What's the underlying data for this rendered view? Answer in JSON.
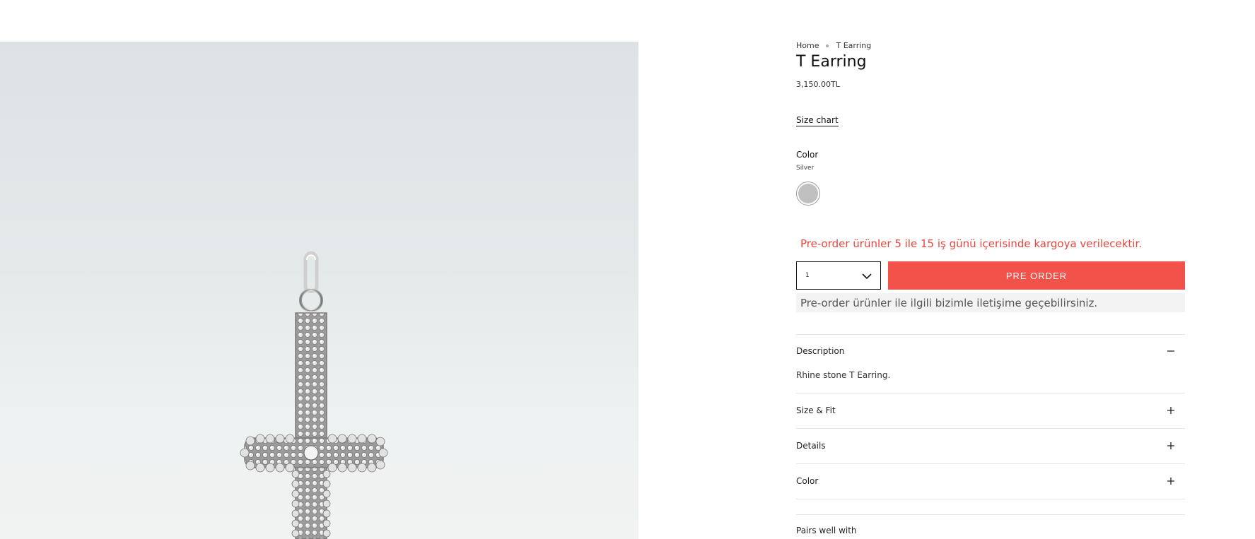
{
  "gallery": {
    "image_alt": "T Earring product photo"
  },
  "breadcrumb": {
    "home": "Home",
    "current": "T Earring"
  },
  "product": {
    "title": "T Earring",
    "price": "3,150.00TL",
    "size_chart": "Size chart",
    "color_label": "Color",
    "color_value": "Silver",
    "swatch_color": "#c0c0c0"
  },
  "preorder": {
    "notice": "Pre-order ürünler 5 ile 15 iş günü içerisinde kargoya verilecektir.",
    "quantity": "1",
    "button_label": "PRE ORDER",
    "contact_note": "Pre-order ürünler ile ilgili bizimle iletişime geçebilirsiniz.",
    "accent_color": "#f25249"
  },
  "accordion": [
    {
      "label": "Description",
      "expanded": true,
      "content": "Rhine stone T Earring.",
      "icon": "minus-icon"
    },
    {
      "label": "Size & Fit",
      "expanded": false,
      "icon": "plus-icon"
    },
    {
      "label": "Details",
      "expanded": false,
      "icon": "plus-icon"
    },
    {
      "label": "Color",
      "expanded": false,
      "icon": "plus-icon"
    }
  ],
  "pairs_well_with": "Pairs well with"
}
